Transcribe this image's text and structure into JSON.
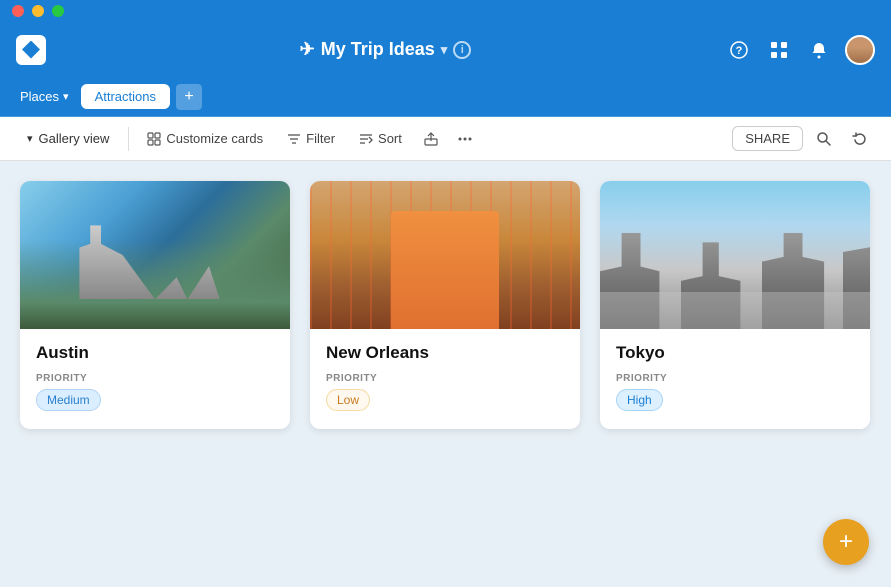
{
  "titlebar": {
    "dots": [
      "red",
      "yellow",
      "green"
    ]
  },
  "header": {
    "title": "My Trip Ideas",
    "chevron": "▾",
    "info": "i",
    "plane": "✈",
    "icons": {
      "help": "?",
      "grid": "⊞",
      "bell": "🔔"
    }
  },
  "tabbar": {
    "places_label": "Places",
    "attractions_label": "Attractions",
    "add_label": "+"
  },
  "toolbar": {
    "gallery_view_label": "Gallery view",
    "customize_cards_label": "Customize cards",
    "filter_label": "Filter",
    "sort_label": "Sort",
    "share_label": "SHARE"
  },
  "cards": [
    {
      "id": "austin",
      "title": "Austin",
      "priority_label": "PRIORITY",
      "priority_value": "Medium",
      "priority_type": "medium"
    },
    {
      "id": "new-orleans",
      "title": "New Orleans",
      "priority_label": "PRIORITY",
      "priority_value": "Low",
      "priority_type": "low"
    },
    {
      "id": "tokyo",
      "title": "Tokyo",
      "priority_label": "PRIORITY",
      "priority_value": "High",
      "priority_type": "high"
    }
  ],
  "fab": {
    "label": "+"
  }
}
